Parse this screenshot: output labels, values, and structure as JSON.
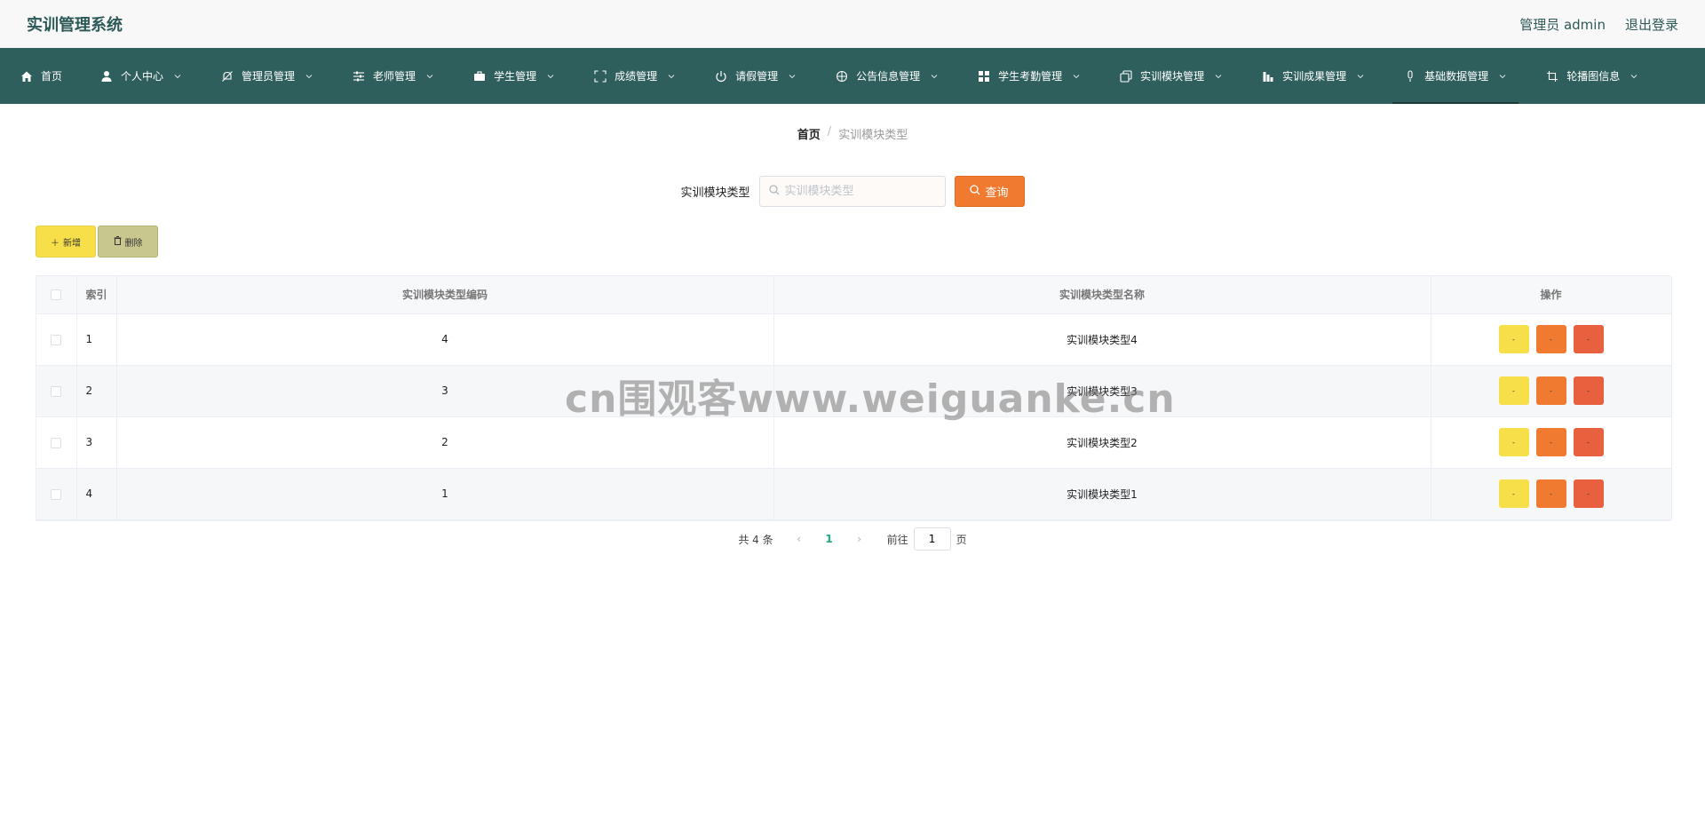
{
  "header": {
    "title": "实训管理系统",
    "user_label": "管理员 admin",
    "logout_label": "退出登录"
  },
  "nav": {
    "items": [
      {
        "label": "首页",
        "icon": "home-icon"
      },
      {
        "label": "个人中心",
        "icon": "user-icon"
      },
      {
        "label": "管理员管理",
        "icon": "bell-off-icon"
      },
      {
        "label": "老师管理",
        "icon": "sliders-icon"
      },
      {
        "label": "学生管理",
        "icon": "briefcase-icon"
      },
      {
        "label": "成绩管理",
        "icon": "fullscreen-icon"
      },
      {
        "label": "请假管理",
        "icon": "power-icon"
      },
      {
        "label": "公告信息管理",
        "icon": "basketball-icon"
      },
      {
        "label": "学生考勤管理",
        "icon": "grid-icon"
      },
      {
        "label": "实训模块管理",
        "icon": "copy-icon"
      },
      {
        "label": "实训成果管理",
        "icon": "chart-icon"
      },
      {
        "label": "基础数据管理",
        "icon": "mic-icon"
      },
      {
        "label": "轮播图信息",
        "icon": "crop-icon"
      }
    ],
    "active_index": 11
  },
  "breadcrumb": {
    "home": "首页",
    "separator": "/",
    "current": "实训模块类型"
  },
  "search": {
    "label": "实训模块类型",
    "placeholder": "实训模块类型",
    "button_label": "查询"
  },
  "actions": {
    "add_label": "新增",
    "delete_label": "删除"
  },
  "table": {
    "columns": [
      "索引",
      "实训模块类型编码",
      "实训模块类型名称",
      "操作"
    ],
    "rows": [
      {
        "index": "1",
        "code": "4",
        "name": "实训模块类型4"
      },
      {
        "index": "2",
        "code": "3",
        "name": "实训模块类型3"
      },
      {
        "index": "3",
        "code": "2",
        "name": "实训模块类型2"
      },
      {
        "index": "4",
        "code": "1",
        "name": "实训模块类型1"
      }
    ],
    "op_labels": [
      "-",
      "-",
      "-"
    ]
  },
  "pagination": {
    "total_text": "共 4 条",
    "current_page": "1",
    "goto_prefix": "前往",
    "goto_value": "1",
    "goto_suffix": "页"
  },
  "watermark": "cn围观客www.weiguanke.cn",
  "colors": {
    "nav_bg": "#2f5f5c",
    "title": "#2d5a58",
    "query_button": "#f07a30",
    "add_button": "#f7df4a",
    "delete_button": "#c8c88e",
    "op_yellow": "#f7df4a",
    "op_orange": "#f07a30",
    "op_red": "#e9603f",
    "active_page": "#1aaf7a"
  }
}
